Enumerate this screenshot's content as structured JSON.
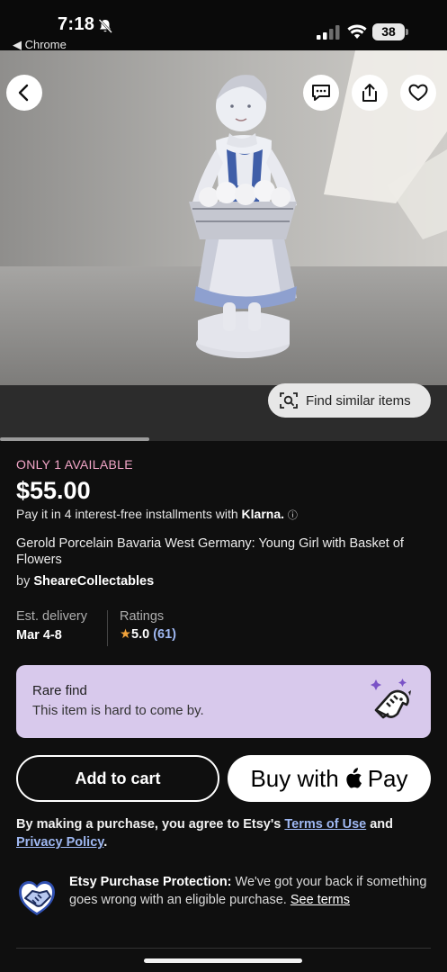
{
  "status_bar": {
    "time": "7:18",
    "back_app": "◀ Chrome",
    "battery": "38"
  },
  "hero": {
    "find_similar_label": "Find similar items"
  },
  "listing": {
    "availability": "ONLY 1 AVAILABLE",
    "price": "$55.00",
    "installments_text": "Pay it in 4 interest-free installments with",
    "installments_brand": "Klarna.",
    "info_mark": "ⓘ",
    "title": "Gerold Porcelain Bavaria West Germany: Young Girl with Basket of Flowers",
    "seller_prefix": "by",
    "seller_name": "SheareCollectables"
  },
  "meta": {
    "delivery_label": "Est. delivery",
    "delivery_value": "Mar 4-8",
    "ratings_label": "Ratings",
    "star": "★",
    "rating_value": "5.0",
    "rating_count": "(61)"
  },
  "rare_find": {
    "title": "Rare find",
    "subtitle": "This item is hard to come by."
  },
  "actions": {
    "add_to_cart": "Add to cart",
    "buy_with": "Buy with",
    "pay": "Pay"
  },
  "agreement": {
    "prefix": "By making a purchase, you agree to Etsy's",
    "terms_link": "Terms of Use",
    "and": "and",
    "privacy_link": "Privacy Policy",
    "suffix": "."
  },
  "protection": {
    "title": "Etsy Purchase Protection:",
    "body": "We've got your back if something goes wrong with an eligible purchase.",
    "link": "See terms"
  },
  "colors": {
    "availability": "#f3a6c8",
    "rare_bg": "#d8c9ec",
    "link": "#9fb8f2",
    "star": "#f1a33b"
  }
}
